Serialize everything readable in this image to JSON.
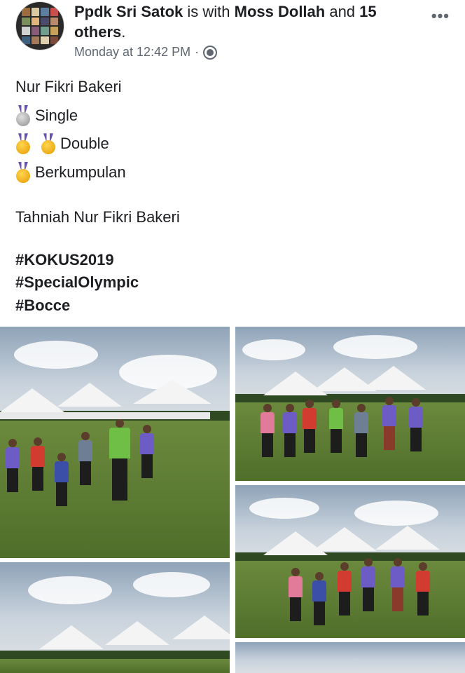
{
  "post": {
    "author": "Ppdk Sri Satok",
    "with_text": " is with ",
    "tagged": "Moss Dollah",
    "and_text": " and ",
    "others": "15 others",
    "period": ".",
    "time": "Monday at 12:42 PM",
    "separator": "·",
    "privacy_icon": "globe-icon",
    "more_icon": "more-options-icon",
    "more_label": "•••"
  },
  "content": {
    "name": "Nur Fikri Bakeri",
    "achievements": [
      {
        "medals": [
          "silver"
        ],
        "label": "Single"
      },
      {
        "medals": [
          "gold",
          "gold"
        ],
        "label": "Double"
      },
      {
        "medals": [
          "gold"
        ],
        "label": "Berkumpulan"
      }
    ],
    "congrats": "Tahniah Nur Fikri Bakeri",
    "hashtags": [
      "#KOKUS2019",
      "#SpecialOlympic",
      "#Bocce"
    ]
  },
  "colors": {
    "text": "#1c1e21",
    "meta": "#606770",
    "gold": "#e59a00",
    "silver": "#8e8e8e"
  },
  "photos": [
    {
      "name": "photo-group-bocce-1",
      "icon": "image-icon"
    },
    {
      "name": "photo-team-celebration",
      "icon": "image-icon"
    },
    {
      "name": "photo-team-celebration-2",
      "icon": "image-icon"
    },
    {
      "name": "photo-tents-field",
      "icon": "image-icon"
    },
    {
      "name": "photo-more",
      "icon": "image-icon"
    }
  ]
}
